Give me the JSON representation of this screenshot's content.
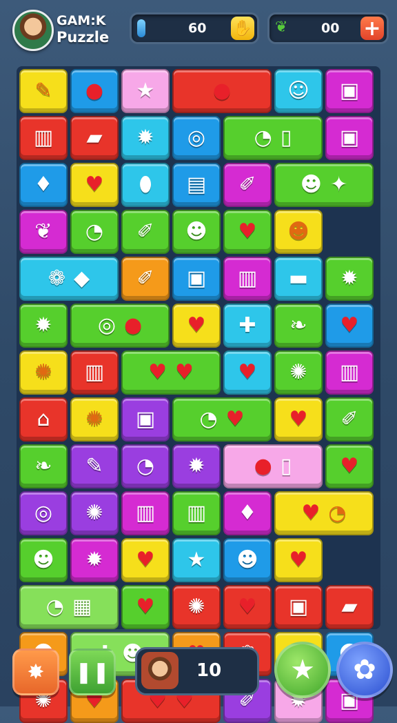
{
  "header": {
    "title_line1": "GAM:K",
    "title_line2": "Puzzle",
    "resource1_value": "60",
    "resource2_value": "00",
    "resource1_icon": "hand-icon",
    "resource2_icon": "leaf-icon"
  },
  "footer": {
    "moves_value": "10",
    "shuffle_icon": "star-burst-icon",
    "pause_icon": "pause-icon",
    "star_icon": "star-icon",
    "menu_icon": "gear-icon"
  },
  "colors": {
    "red": "#e8342a",
    "blue": "#1f9be8",
    "pink": "#f7a8e8",
    "cyan": "#2ec6ea",
    "magenta": "#d52bd2",
    "yellow": "#f6df1b",
    "green": "#56cf2d",
    "orange": "#f59a1a",
    "lightgreen": "#86e05a",
    "purple": "#9a3ee0"
  },
  "board": [
    [
      {
        "c": "yellow",
        "s": [
          "feather"
        ]
      },
      {
        "c": "blue",
        "s": [
          "apple"
        ]
      },
      {
        "c": "pink",
        "s": [
          "star"
        ]
      },
      {
        "c": "red",
        "w": true,
        "s": [
          "apple"
        ]
      },
      {
        "c": "cyan",
        "s": [
          "smile"
        ]
      },
      {
        "c": "magenta",
        "s": [
          "robot"
        ]
      },
      {
        "c": "red",
        "s": [
          "basket"
        ]
      }
    ],
    [
      {
        "c": "red",
        "s": [
          "bottle"
        ]
      },
      {
        "c": "cyan",
        "s": [
          "monster"
        ]
      },
      {
        "c": "blue",
        "s": [
          "ring"
        ]
      },
      {
        "c": "green",
        "w": true,
        "s": [
          "bubble",
          "phone"
        ]
      },
      {
        "c": "magenta",
        "s": [
          "robot"
        ]
      },
      {
        "c": "blue",
        "s": [
          "drop"
        ]
      },
      {
        "c": "yellow",
        "s": [
          "heart"
        ]
      }
    ],
    [
      {
        "c": "cyan",
        "s": [
          "balloon"
        ]
      },
      {
        "c": "blue",
        "s": [
          "radio"
        ]
      },
      {
        "c": "magenta",
        "s": [
          "pen"
        ]
      },
      {
        "c": "green",
        "w": true,
        "s": [
          "face",
          "pineapple"
        ]
      },
      {
        "c": "magenta",
        "s": [
          "bird"
        ]
      },
      {
        "c": "green",
        "s": [
          "bubble"
        ]
      },
      {
        "c": "green",
        "s": [
          "pen"
        ]
      }
    ],
    [
      {
        "c": "green",
        "s": [
          "face"
        ]
      },
      {
        "c": "green",
        "s": [
          "heart"
        ]
      },
      {
        "c": "yellow",
        "s": [
          "face"
        ]
      },
      {
        "c": "cyan",
        "w": true,
        "s": [
          "fruit",
          "gem"
        ]
      },
      {
        "c": "orange",
        "s": [
          "pen"
        ]
      },
      {
        "c": "blue",
        "s": [
          "robot"
        ]
      },
      {
        "c": "magenta",
        "s": [
          "basket"
        ]
      }
    ],
    [
      {
        "c": "cyan",
        "s": [
          "cake"
        ]
      },
      {
        "c": "green",
        "s": [
          "monster"
        ]
      },
      {
        "c": "green",
        "s": [
          "monster"
        ]
      },
      {
        "c": "green",
        "w": true,
        "s": [
          "ring",
          "apple"
        ]
      },
      {
        "c": "yellow",
        "s": [
          "heart"
        ]
      },
      {
        "c": "cyan",
        "s": [
          "puzzle"
        ]
      },
      {
        "c": "green",
        "s": [
          "leaf"
        ]
      }
    ],
    [
      {
        "c": "blue",
        "s": [
          "heart"
        ]
      },
      {
        "c": "yellow",
        "s": [
          "sun"
        ]
      },
      {
        "c": "red",
        "s": [
          "basket"
        ]
      },
      {
        "c": "green",
        "w": true,
        "s": [
          "heart",
          "heart"
        ]
      },
      {
        "c": "cyan",
        "s": [
          "heart"
        ]
      },
      {
        "c": "green",
        "s": [
          "sun"
        ]
      },
      {
        "c": "magenta",
        "s": [
          "basket"
        ]
      }
    ],
    [
      {
        "c": "red",
        "s": [
          "house"
        ]
      },
      {
        "c": "yellow",
        "s": [
          "sun"
        ]
      },
      {
        "c": "purple",
        "s": [
          "robot"
        ]
      },
      {
        "c": "green",
        "w": true,
        "s": [
          "bubble",
          "heart"
        ]
      },
      {
        "c": "yellow",
        "s": [
          "heart"
        ]
      },
      {
        "c": "green",
        "s": [
          "pen"
        ]
      },
      {
        "c": "green",
        "s": [
          "leaf"
        ]
      }
    ],
    [
      {
        "c": "purple",
        "s": [
          "feather"
        ]
      },
      {
        "c": "purple",
        "s": [
          "bubble"
        ]
      },
      {
        "c": "purple",
        "s": [
          "monster"
        ]
      },
      {
        "c": "pink",
        "w": true,
        "s": [
          "apple",
          "phone"
        ]
      },
      {
        "c": "green",
        "s": [
          "heart"
        ]
      },
      {
        "c": "purple",
        "s": [
          "ring"
        ]
      },
      {
        "c": "purple",
        "s": [
          "sun"
        ]
      }
    ],
    [
      {
        "c": "magenta",
        "s": [
          "basket"
        ]
      },
      {
        "c": "green",
        "s": [
          "basket"
        ]
      },
      {
        "c": "magenta",
        "s": [
          "drop"
        ]
      },
      {
        "c": "yellow",
        "w": true,
        "s": [
          "heart",
          "bubble"
        ]
      },
      {
        "c": "green",
        "s": [
          "face"
        ]
      },
      {
        "c": "magenta",
        "s": [
          "monster"
        ]
      },
      {
        "c": "yellow",
        "s": [
          "heart"
        ]
      }
    ],
    [
      {
        "c": "cyan",
        "s": [
          "star"
        ]
      },
      {
        "c": "blue",
        "s": [
          "face"
        ]
      },
      {
        "c": "yellow",
        "s": [
          "heart"
        ]
      },
      {
        "c": "lightgreen",
        "w": true,
        "s": [
          "bubble",
          "gift"
        ]
      },
      {
        "c": "green",
        "s": [
          "heart"
        ]
      },
      {
        "c": "red",
        "s": [
          "sun"
        ]
      },
      {
        "c": "red",
        "s": [
          "heart"
        ]
      }
    ],
    [
      {
        "c": "red",
        "s": [
          "robot"
        ]
      },
      {
        "c": "red",
        "s": [
          "bottle"
        ]
      },
      {
        "c": "orange",
        "s": [
          "face"
        ]
      },
      {
        "c": "lightgreen",
        "w": true,
        "s": [
          "puzzle",
          "face"
        ]
      },
      {
        "c": "orange",
        "s": [
          "heart"
        ]
      },
      {
        "c": "red",
        "s": [
          "fruit"
        ]
      },
      {
        "c": "yellow",
        "s": [
          "leaf"
        ]
      }
    ],
    [
      {
        "c": "blue",
        "s": [
          "face"
        ]
      },
      {
        "c": "red",
        "s": [
          "sun"
        ]
      },
      {
        "c": "orange",
        "s": [
          "heart"
        ]
      },
      {
        "c": "red",
        "w": true,
        "s": [
          "heart",
          "heart"
        ]
      },
      {
        "c": "purple",
        "s": [
          "pen"
        ]
      },
      {
        "c": "pink",
        "s": [
          "monster"
        ]
      },
      {
        "c": "magenta",
        "s": [
          "robot"
        ]
      }
    ]
  ],
  "symbols": {
    "feather": "✎",
    "apple": "●",
    "star": "★",
    "smile": "☺",
    "robot": "▣",
    "basket": "▥",
    "bottle": "▰",
    "monster": "✹",
    "ring": "◎",
    "bubble": "◔",
    "phone": "▯",
    "drop": "♦",
    "heart": "♥",
    "balloon": "⬮",
    "radio": "▤",
    "pen": "✐",
    "face": "☻",
    "pineapple": "✦",
    "bird": "❦",
    "fruit": "❁",
    "gem": "◆",
    "cake": "▬",
    "puzzle": "✚",
    "leaf": "❧",
    "sun": "✺",
    "house": "⌂",
    "gift": "▦"
  }
}
